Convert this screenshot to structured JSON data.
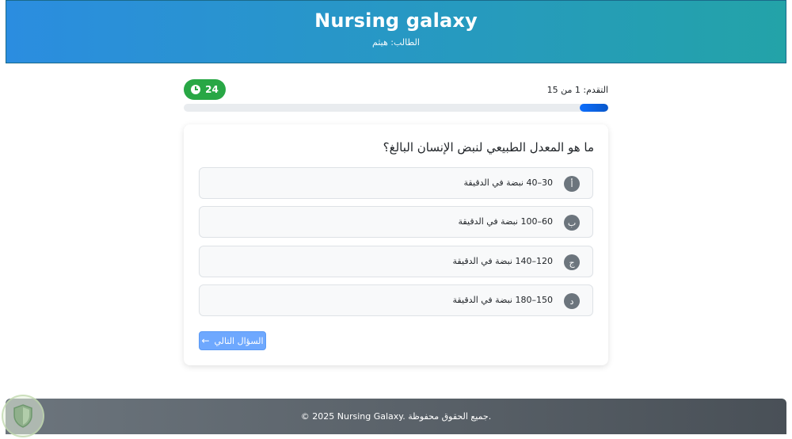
{
  "header": {
    "title": "Nursing galaxy",
    "student": "الطالب: هيثم"
  },
  "timer": {
    "value": "24",
    "icon": "clock-icon",
    "color": "#28a745"
  },
  "progress": {
    "label": "التقدم: 1 من 15",
    "current": 1,
    "total": 15,
    "fraction": 0.067
  },
  "quiz": {
    "question": "ما هو المعدل الطبيعي لنبض الإنسان البالغ؟",
    "options": [
      {
        "letter": "أ",
        "text": "30–40 نبضة في الدقيقة"
      },
      {
        "letter": "ب",
        "text": "60–100 نبضة في الدقيقة"
      },
      {
        "letter": "ج",
        "text": "120–140 نبضة في الدقيقة"
      },
      {
        "letter": "د",
        "text": "150–180 نبضة في الدقيقة"
      }
    ],
    "next_label": "السؤال التالي",
    "next_icon": "arrow-left-icon"
  },
  "footer": {
    "text": "© 2025 Nursing Galaxy. جميع الحقوق محفوظة."
  },
  "colors": {
    "header_start": "#2b8de0",
    "header_end": "#23a3a8",
    "accent": "#0d6efd",
    "footer": "#5a6268"
  }
}
